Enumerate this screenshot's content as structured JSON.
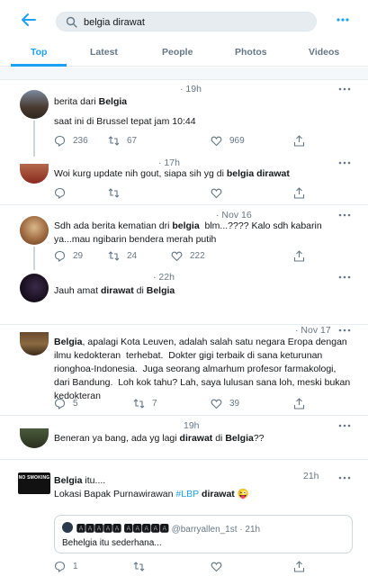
{
  "search": {
    "query": "belgia dirawat"
  },
  "tabs": [
    "Top",
    "Latest",
    "People",
    "Photos",
    "Videos"
  ],
  "tweets": [
    {
      "time": "· 19h",
      "text_pre": "berita dari ",
      "text_bold": "Belgia",
      "line2": "saat ini di Brussel tepat jam 10:44",
      "reply": "236",
      "retweet": "67",
      "like": "969"
    },
    {
      "time": "· 17h",
      "text_pre": "Woi kurg update nih gout, siapa sih yg di ",
      "text_bold": "belgia dirawat"
    },
    {
      "time": "· Nov 16",
      "text_pre": "Sdh ada berita kematian dri ",
      "text_bold": "belgia",
      "text_post": "  blm...???? Kalo sdh kabarin ya...mau ngibarin bendera merah putih",
      "reply": "29",
      "retweet": "24",
      "like": "222"
    },
    {
      "time": "· 22h",
      "text_pre": "Jauh amat ",
      "text_bold": "dirawat",
      "text_mid": " di ",
      "text_bold2": "Belgia"
    },
    {
      "time": "· Nov 17",
      "text_bold": "Belgia",
      "text_post": ", apalagi Kota Leuven, adalah salah satu negara Eropa dengan ilmu kedokteran  terhebat.  Dokter gigi terbaik di sana keturunan rionghoa-Indonesia.  Juga seorang almarhum profesor farmakologi, dari Bandung.  Loh kok tahu? Lah, saya lulusan sana loh, meski bukan kedokteran",
      "reply": "5",
      "retweet": "7",
      "like": "39"
    },
    {
      "time": "19h",
      "text_pre": "Beneran ya bang, ada yg lagi ",
      "text_bold": "dirawat",
      "text_mid": " di ",
      "text_bold2": "Belgia",
      "text_post": "??"
    },
    {
      "time": "21h",
      "text_bold": "Belgia",
      "text_post": " itu....",
      "line2_pre": "Lokasi Bapak Purnawirawan ",
      "hashtag": "#LBP",
      "line2_bold": " dirawat",
      "emoji": "😜",
      "reply": "1",
      "quote": {
        "name": "🅰🅰🅰🅰🅰 🅰🅰🅰🅰🅰",
        "handle": "@barryallen_1st · 21h",
        "text": "Behelgia itu sederhana..."
      }
    }
  ],
  "colors": {
    "accent": "#1da1f2",
    "muted": "#657786",
    "border": "#e6ecf0"
  }
}
